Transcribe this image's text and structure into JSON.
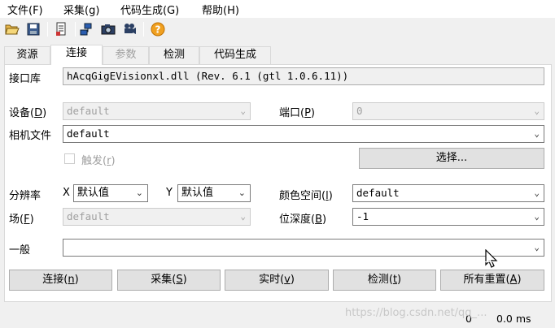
{
  "menu": {
    "file": "文件(F)",
    "acquire": "采集(g)",
    "codegen": "代码生成(G)",
    "help": "帮助(H)"
  },
  "toolbar": {
    "icons": [
      "open-folder-icon",
      "save-icon",
      "properties-icon",
      "network-icon",
      "camera-icon",
      "video-camera-icon",
      "help-icon"
    ]
  },
  "tabs": [
    "资源",
    "连接",
    "参数",
    "检测",
    "代码生成"
  ],
  "connection": {
    "interface_label": "接口库",
    "interface_value": "hAcqGigEVisionxl.dll (Rev. 6.1 (gtl 1.0.6.11))",
    "device_label": "设备(D)",
    "device_value": "default",
    "port_label": "端口(P)",
    "port_value": "0",
    "camera_file_label": "相机文件",
    "camera_file_value": "default",
    "trigger_label": "触发(r)",
    "select_button": "选择...",
    "resolution_label": "分辨率",
    "x_label": "X",
    "x_value": "默认值",
    "y_label": "Y",
    "y_value": "默认值",
    "color_space_label": "颜色空间(l)",
    "color_space_value": "default",
    "field_label": "场(F)",
    "field_value": "default",
    "bit_depth_label": "位深度(B)",
    "bit_depth_value": "-1",
    "general_label": "一般",
    "general_value": ""
  },
  "buttons": {
    "connect": "连接(n)",
    "acquire": "采集(S)",
    "live": "实时(v)",
    "detect": "检测(t)",
    "reset_all": "所有重置(A)"
  },
  "status": {
    "frames": "0",
    "time": "0.0 ms"
  },
  "watermark": "https://blog.csdn.net/qq_..."
}
